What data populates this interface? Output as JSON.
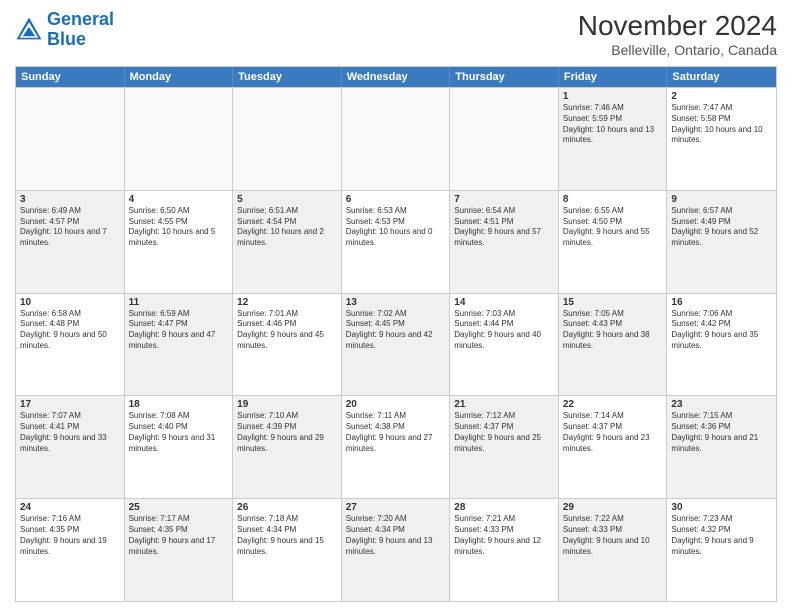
{
  "header": {
    "logo_line1": "General",
    "logo_line2": "Blue",
    "title": "November 2024",
    "subtitle": "Belleville, Ontario, Canada"
  },
  "weekdays": [
    "Sunday",
    "Monday",
    "Tuesday",
    "Wednesday",
    "Thursday",
    "Friday",
    "Saturday"
  ],
  "rows": [
    [
      {
        "day": "",
        "info": "",
        "empty": true
      },
      {
        "day": "",
        "info": "",
        "empty": true
      },
      {
        "day": "",
        "info": "",
        "empty": true
      },
      {
        "day": "",
        "info": "",
        "empty": true
      },
      {
        "day": "",
        "info": "",
        "empty": true
      },
      {
        "day": "1",
        "info": "Sunrise: 7:46 AM\nSunset: 5:59 PM\nDaylight: 10 hours and 13 minutes.",
        "shaded": true
      },
      {
        "day": "2",
        "info": "Sunrise: 7:47 AM\nSunset: 5:58 PM\nDaylight: 10 hours and 10 minutes.",
        "shaded": false
      }
    ],
    [
      {
        "day": "3",
        "info": "Sunrise: 6:49 AM\nSunset: 4:57 PM\nDaylight: 10 hours and 7 minutes.",
        "shaded": true
      },
      {
        "day": "4",
        "info": "Sunrise: 6:50 AM\nSunset: 4:55 PM\nDaylight: 10 hours and 5 minutes.",
        "shaded": false
      },
      {
        "day": "5",
        "info": "Sunrise: 6:51 AM\nSunset: 4:54 PM\nDaylight: 10 hours and 2 minutes.",
        "shaded": true
      },
      {
        "day": "6",
        "info": "Sunrise: 6:53 AM\nSunset: 4:53 PM\nDaylight: 10 hours and 0 minutes.",
        "shaded": false
      },
      {
        "day": "7",
        "info": "Sunrise: 6:54 AM\nSunset: 4:51 PM\nDaylight: 9 hours and 57 minutes.",
        "shaded": true
      },
      {
        "day": "8",
        "info": "Sunrise: 6:55 AM\nSunset: 4:50 PM\nDaylight: 9 hours and 55 minutes.",
        "shaded": false
      },
      {
        "day": "9",
        "info": "Sunrise: 6:57 AM\nSunset: 4:49 PM\nDaylight: 9 hours and 52 minutes.",
        "shaded": true
      }
    ],
    [
      {
        "day": "10",
        "info": "Sunrise: 6:58 AM\nSunset: 4:48 PM\nDaylight: 9 hours and 50 minutes.",
        "shaded": false
      },
      {
        "day": "11",
        "info": "Sunrise: 6:59 AM\nSunset: 4:47 PM\nDaylight: 9 hours and 47 minutes.",
        "shaded": true
      },
      {
        "day": "12",
        "info": "Sunrise: 7:01 AM\nSunset: 4:46 PM\nDaylight: 9 hours and 45 minutes.",
        "shaded": false
      },
      {
        "day": "13",
        "info": "Sunrise: 7:02 AM\nSunset: 4:45 PM\nDaylight: 9 hours and 42 minutes.",
        "shaded": true
      },
      {
        "day": "14",
        "info": "Sunrise: 7:03 AM\nSunset: 4:44 PM\nDaylight: 9 hours and 40 minutes.",
        "shaded": false
      },
      {
        "day": "15",
        "info": "Sunrise: 7:05 AM\nSunset: 4:43 PM\nDaylight: 9 hours and 38 minutes.",
        "shaded": true
      },
      {
        "day": "16",
        "info": "Sunrise: 7:06 AM\nSunset: 4:42 PM\nDaylight: 9 hours and 35 minutes.",
        "shaded": false
      }
    ],
    [
      {
        "day": "17",
        "info": "Sunrise: 7:07 AM\nSunset: 4:41 PM\nDaylight: 9 hours and 33 minutes.",
        "shaded": true
      },
      {
        "day": "18",
        "info": "Sunrise: 7:08 AM\nSunset: 4:40 PM\nDaylight: 9 hours and 31 minutes.",
        "shaded": false
      },
      {
        "day": "19",
        "info": "Sunrise: 7:10 AM\nSunset: 4:39 PM\nDaylight: 9 hours and 29 minutes.",
        "shaded": true
      },
      {
        "day": "20",
        "info": "Sunrise: 7:11 AM\nSunset: 4:38 PM\nDaylight: 9 hours and 27 minutes.",
        "shaded": false
      },
      {
        "day": "21",
        "info": "Sunrise: 7:12 AM\nSunset: 4:37 PM\nDaylight: 9 hours and 25 minutes.",
        "shaded": true
      },
      {
        "day": "22",
        "info": "Sunrise: 7:14 AM\nSunset: 4:37 PM\nDaylight: 9 hours and 23 minutes.",
        "shaded": false
      },
      {
        "day": "23",
        "info": "Sunrise: 7:15 AM\nSunset: 4:36 PM\nDaylight: 9 hours and 21 minutes.",
        "shaded": true
      }
    ],
    [
      {
        "day": "24",
        "info": "Sunrise: 7:16 AM\nSunset: 4:35 PM\nDaylight: 9 hours and 19 minutes.",
        "shaded": false
      },
      {
        "day": "25",
        "info": "Sunrise: 7:17 AM\nSunset: 4:35 PM\nDaylight: 9 hours and 17 minutes.",
        "shaded": true
      },
      {
        "day": "26",
        "info": "Sunrise: 7:18 AM\nSunset: 4:34 PM\nDaylight: 9 hours and 15 minutes.",
        "shaded": false
      },
      {
        "day": "27",
        "info": "Sunrise: 7:20 AM\nSunset: 4:34 PM\nDaylight: 9 hours and 13 minutes.",
        "shaded": true
      },
      {
        "day": "28",
        "info": "Sunrise: 7:21 AM\nSunset: 4:33 PM\nDaylight: 9 hours and 12 minutes.",
        "shaded": false
      },
      {
        "day": "29",
        "info": "Sunrise: 7:22 AM\nSunset: 4:33 PM\nDaylight: 9 hours and 10 minutes.",
        "shaded": true
      },
      {
        "day": "30",
        "info": "Sunrise: 7:23 AM\nSunset: 4:32 PM\nDaylight: 9 hours and 9 minutes.",
        "shaded": false
      }
    ]
  ]
}
